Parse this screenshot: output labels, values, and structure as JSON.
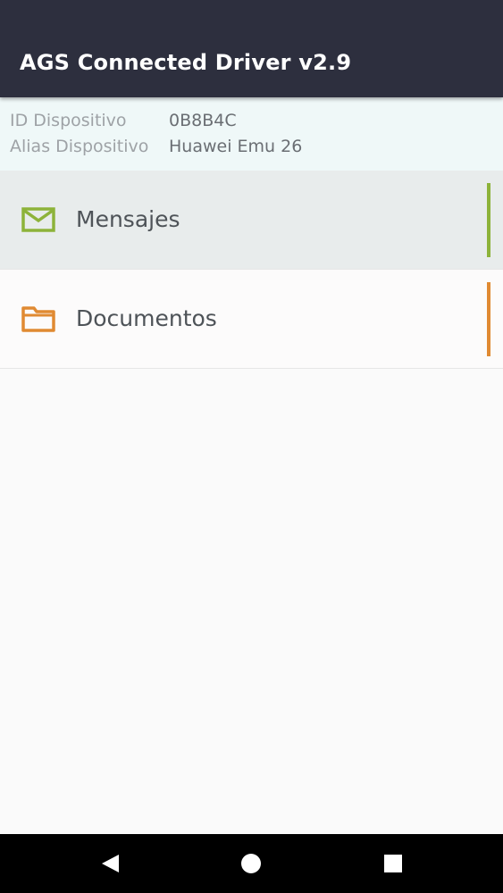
{
  "app": {
    "title": "AGS Connected Driver v2.9"
  },
  "device_info": {
    "id_label": "ID Dispositivo",
    "id_value": "0B8B4C",
    "alias_label": "Alias Dispositivo",
    "alias_value": "Huawei Emu 26"
  },
  "menu": {
    "items": [
      {
        "label": "Mensajes",
        "icon": "envelope-icon",
        "accent_color": "#8db33a",
        "selected": true
      },
      {
        "label": "Documentos",
        "icon": "folder-icon",
        "accent_color": "#e08a32",
        "selected": false
      }
    ]
  },
  "navbar": {
    "back_icon": "back-triangle-icon",
    "home_icon": "home-circle-icon",
    "recents_icon": "recents-square-icon"
  },
  "colors": {
    "appbar": "#2d2f3e",
    "info_background": "#eff8f8",
    "mensajes_accent": "#8db33a",
    "documentos_accent": "#e08a32"
  }
}
